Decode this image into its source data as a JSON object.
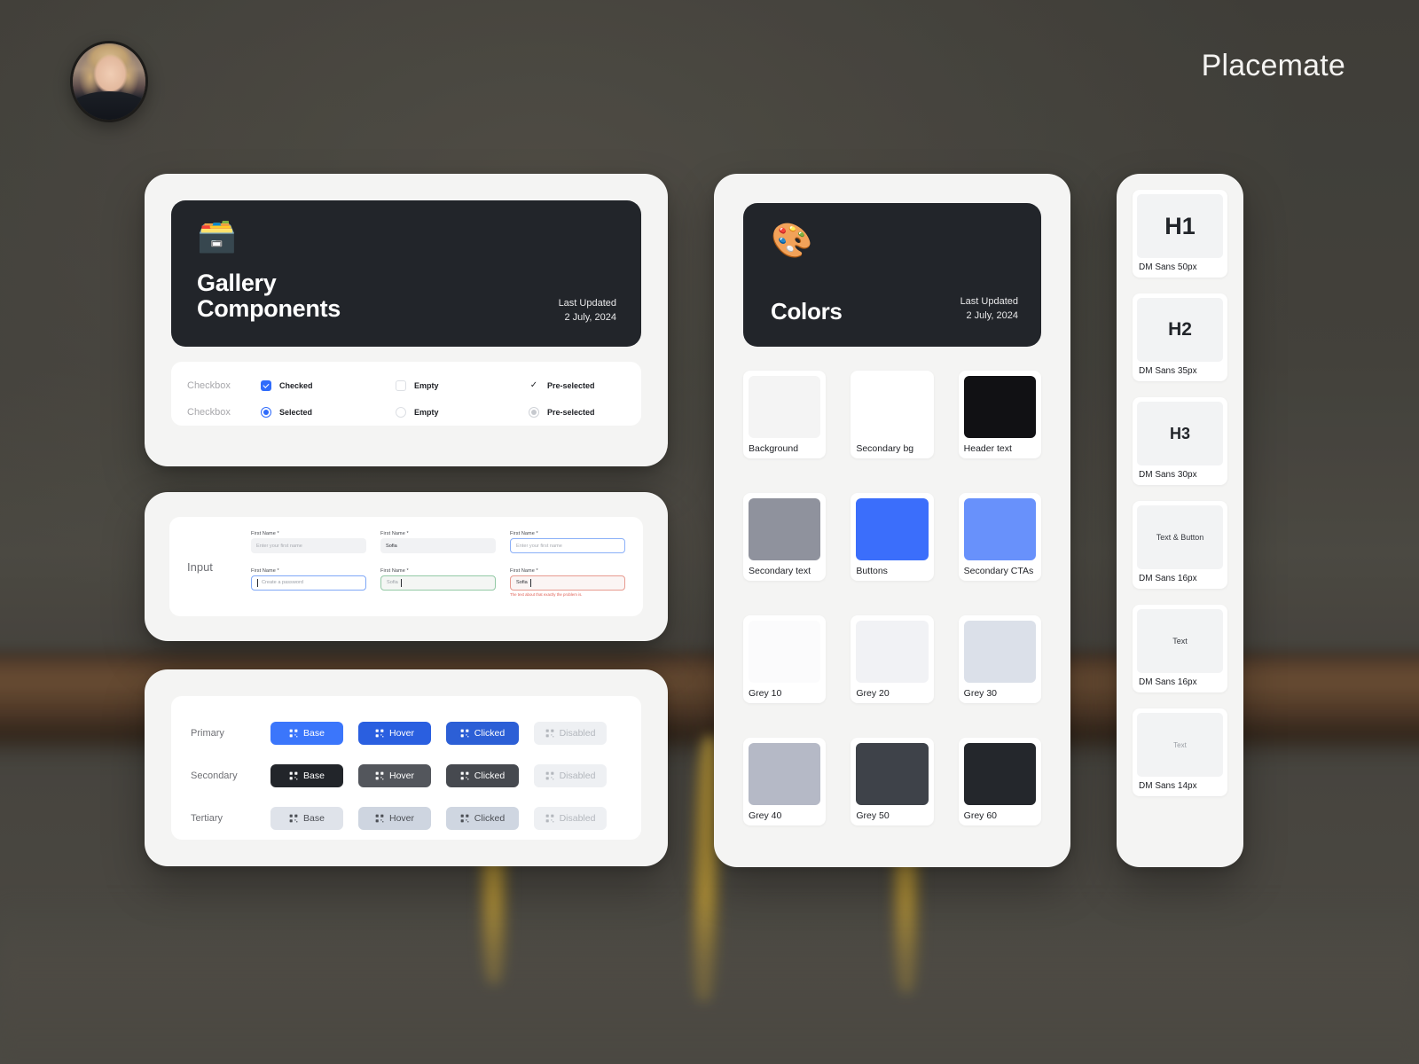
{
  "header": {
    "brand": "Placemate",
    "avatar_alt": "user-avatar"
  },
  "gallery_panel": {
    "card": {
      "emoji": "🗃️",
      "title_line1": "Gallery",
      "title_line2": "Components",
      "meta_label": "Last Updated",
      "meta_date": "2 July, 2024"
    },
    "checkbox_row": {
      "label": "Checkbox",
      "items": [
        {
          "state": "checked",
          "text": "Checked"
        },
        {
          "state": "empty",
          "text": "Empty"
        },
        {
          "state": "preselected",
          "text": "Pre-selected"
        }
      ]
    },
    "radio_row": {
      "label": "Checkbox",
      "items": [
        {
          "state": "selected",
          "text": "Selected"
        },
        {
          "state": "empty",
          "text": "Empty"
        },
        {
          "state": "preselected",
          "text": "Pre-selected"
        }
      ]
    }
  },
  "input_panel": {
    "section_label": "Input",
    "fields": [
      {
        "label": "First Name *",
        "value": "",
        "placeholder": "Enter your first name",
        "state": "filled-empty"
      },
      {
        "label": "First Name *",
        "value": "Sofia",
        "placeholder": "",
        "state": "filled-value"
      },
      {
        "label": "First Name *",
        "value": "",
        "placeholder": "Enter your first name",
        "state": "focus-blue"
      },
      {
        "label": "First Name *",
        "value": "",
        "placeholder": "Create a password",
        "state": "focus-blue2"
      },
      {
        "label": "First Name *",
        "value": "Sofia",
        "placeholder": "",
        "state": "ok-green"
      },
      {
        "label": "First Name *",
        "value": "Sofia",
        "placeholder": "",
        "state": "err-red",
        "error": "The text about that exactly the problem is."
      }
    ]
  },
  "buttons_panel": {
    "rows": [
      {
        "label": "Primary",
        "buttons": [
          {
            "text": "Base",
            "style": "p-base"
          },
          {
            "text": "Hover",
            "style": "p-hover"
          },
          {
            "text": "Clicked",
            "style": "p-click"
          },
          {
            "text": "Disabled",
            "style": "disabled"
          }
        ]
      },
      {
        "label": "Secondary",
        "buttons": [
          {
            "text": "Base",
            "style": "s-base"
          },
          {
            "text": "Hover",
            "style": "s-hover"
          },
          {
            "text": "Clicked",
            "style": "s-click"
          },
          {
            "text": "Disabled",
            "style": "disabled"
          }
        ]
      },
      {
        "label": "Tertiary",
        "buttons": [
          {
            "text": "Base",
            "style": "t-base"
          },
          {
            "text": "Hover",
            "style": "t-hover"
          },
          {
            "text": "Clicked",
            "style": "t-click"
          },
          {
            "text": "Disabled",
            "style": "disabled"
          }
        ]
      }
    ]
  },
  "colors_panel": {
    "card": {
      "emoji": "🎨",
      "title": "Colors",
      "meta_label": "Last Updated",
      "meta_date": "2 July, 2024"
    },
    "swatches": [
      {
        "name": "Background",
        "hex": "#f4f4f4"
      },
      {
        "name": "Secondary bg",
        "hex": "#ffffff"
      },
      {
        "name": "Header text",
        "hex": "#111114"
      },
      {
        "name": "Secondary text",
        "hex": "#8f929d"
      },
      {
        "name": "Buttons",
        "hex": "#3b6efb"
      },
      {
        "name": "Secondary CTAs",
        "hex": "#6891fb"
      },
      {
        "name": "Grey 10",
        "hex": "#fbfbfc"
      },
      {
        "name": "Grey 20",
        "hex": "#f1f2f5"
      },
      {
        "name": "Grey 30",
        "hex": "#dbe0e9"
      },
      {
        "name": "Grey 40",
        "hex": "#b5b9c6"
      },
      {
        "name": "Grey 50",
        "hex": "#3e4249"
      },
      {
        "name": "Grey 60",
        "hex": "#24272c"
      }
    ]
  },
  "typography_panel": {
    "items": [
      {
        "sample": "H1",
        "spec": "DM Sans 50px"
      },
      {
        "sample": "H2",
        "spec": "DM Sans 35px"
      },
      {
        "sample": "H3",
        "spec": "DM Sans 30px"
      },
      {
        "sample": "Text & Button",
        "spec": "DM Sans 16px"
      },
      {
        "sample": "Text",
        "spec": "DM Sans 16px"
      },
      {
        "sample": "Text",
        "spec": "DM Sans 14px"
      }
    ]
  }
}
